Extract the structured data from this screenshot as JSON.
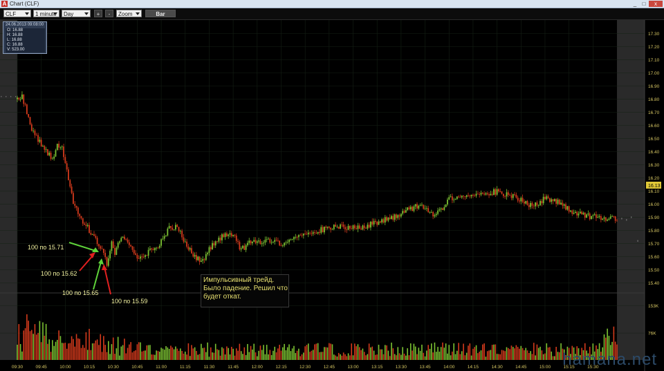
{
  "window": {
    "title": "Chart (CLF)",
    "controls": [
      "_",
      "□",
      "x"
    ]
  },
  "toolbar": {
    "symbol": "CLF",
    "interval": "1 minute",
    "period": "Day",
    "zoom_in": "+",
    "zoom_out": "-",
    "zoom": "Zoom",
    "bar_type": "Bar"
  },
  "info": {
    "timestamp": "24.06.2013 09:08:00",
    "open": "O: 16.88",
    "high": "H: 16.88",
    "low": "L: 16.88",
    "close": "C: 16.88",
    "volume": "V: 523.00"
  },
  "annotations": {
    "a1": "100 по 15.71",
    "a2": "100 по 15.62",
    "a3": "100 по 15.65",
    "a4": "100 по 15.59"
  },
  "comment_lines": [
    "Импульсивный трейд.",
    "Было падение. Решил что",
    "будет откат."
  ],
  "watermark": "hamana.net",
  "colors": {
    "up": "#7cc232",
    "down": "#d43a1c",
    "grid": "#152015",
    "axis_text": "#d8c864",
    "shade": "#2a2a2a",
    "arrow_green": "#5fd33a",
    "arrow_red": "#e02020"
  },
  "chart_data": {
    "type": "candlestick",
    "price_ticks": [
      "17.30",
      "17.20",
      "17.10",
      "17.00",
      "16.90",
      "16.80",
      "16.70",
      "16.60",
      "16.50",
      "16.40",
      "16.30",
      "16.20",
      "16.10",
      "16.00",
      "15.90",
      "15.80",
      "15.70",
      "15.60",
      "15.50",
      "15.40"
    ],
    "ylim": [
      15.35,
      17.35
    ],
    "last_price_label": "16.13",
    "volume_ticks": [
      "153K",
      "76K"
    ],
    "volume_max": 153000,
    "time_ticks": [
      "09:30",
      "09:45",
      "10:00",
      "10:15",
      "10:30",
      "10:45",
      "11:00",
      "11:15",
      "11:30",
      "11:45",
      "12:00",
      "12:15",
      "12:30",
      "12:45",
      "13:00",
      "13:15",
      "13:30",
      "13:45",
      "14:00",
      "14:15",
      "14:30",
      "14:45",
      "15:00",
      "15:15",
      "15:30"
    ],
    "time_range": [
      "09:30",
      "15:45"
    ],
    "price_path": [
      [
        "09:08",
        16.88
      ],
      [
        "09:30",
        16.8
      ],
      [
        "09:33",
        16.83
      ],
      [
        "09:38",
        16.6
      ],
      [
        "09:45",
        16.45
      ],
      [
        "09:52",
        16.35
      ],
      [
        "09:55",
        16.45
      ],
      [
        "09:58",
        16.42
      ],
      [
        "10:00",
        16.3
      ],
      [
        "10:05",
        16.0
      ],
      [
        "10:10",
        15.88
      ],
      [
        "10:15",
        15.8
      ],
      [
        "10:20",
        15.71
      ],
      [
        "10:23",
        15.65
      ],
      [
        "10:26",
        15.55
      ],
      [
        "10:29",
        15.72
      ],
      [
        "10:31",
        15.62
      ],
      [
        "10:33",
        15.7
      ],
      [
        "10:36",
        15.74
      ],
      [
        "10:40",
        15.68
      ],
      [
        "10:45",
        15.58
      ],
      [
        "10:50",
        15.62
      ],
      [
        "10:55",
        15.65
      ],
      [
        "11:00",
        15.72
      ],
      [
        "11:05",
        15.82
      ],
      [
        "11:10",
        15.84
      ],
      [
        "11:15",
        15.7
      ],
      [
        "11:20",
        15.62
      ],
      [
        "11:25",
        15.55
      ],
      [
        "11:30",
        15.66
      ],
      [
        "11:35",
        15.72
      ],
      [
        "11:40",
        15.78
      ],
      [
        "11:45",
        15.76
      ],
      [
        "11:50",
        15.66
      ],
      [
        "11:55",
        15.7
      ],
      [
        "12:00",
        15.72
      ],
      [
        "12:10",
        15.72
      ],
      [
        "12:15",
        15.7
      ],
      [
        "12:25",
        15.74
      ],
      [
        "12:35",
        15.78
      ],
      [
        "12:45",
        15.83
      ],
      [
        "12:55",
        15.83
      ],
      [
        "13:05",
        15.82
      ],
      [
        "13:15",
        15.86
      ],
      [
        "13:25",
        15.9
      ],
      [
        "13:30",
        15.93
      ],
      [
        "13:35",
        15.96
      ],
      [
        "13:40",
        15.99
      ],
      [
        "13:45",
        15.96
      ],
      [
        "13:50",
        15.93
      ],
      [
        "13:55",
        15.95
      ],
      [
        "14:00",
        16.04
      ],
      [
        "14:05",
        16.06
      ],
      [
        "14:10",
        16.05
      ],
      [
        "14:15",
        16.05
      ],
      [
        "14:20",
        16.07
      ],
      [
        "14:25",
        16.08
      ],
      [
        "14:30",
        16.1
      ],
      [
        "14:35",
        16.08
      ],
      [
        "14:40",
        16.06
      ],
      [
        "14:45",
        16.04
      ],
      [
        "14:50",
        15.99
      ],
      [
        "14:55",
        16.0
      ],
      [
        "15:00",
        16.04
      ],
      [
        "15:05",
        16.03
      ],
      [
        "15:10",
        16.0
      ],
      [
        "15:15",
        15.96
      ],
      [
        "15:20",
        15.92
      ],
      [
        "15:25",
        15.92
      ],
      [
        "15:30",
        15.9
      ],
      [
        "15:35",
        15.89
      ],
      [
        "15:40",
        15.9
      ],
      [
        "15:45",
        15.88
      ]
    ]
  }
}
